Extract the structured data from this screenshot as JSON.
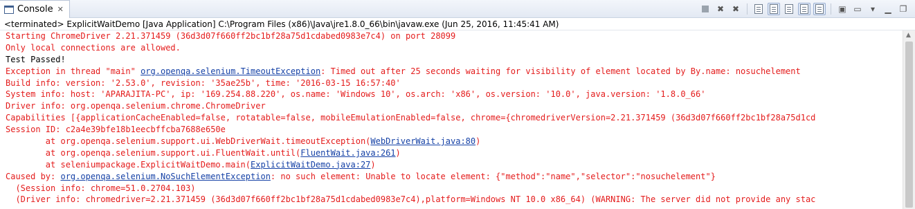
{
  "tab": {
    "label": "Console",
    "close": "✕",
    "icon": "console-icon"
  },
  "toolbar": {
    "icons": [
      "terminate-icon",
      "remove-launch-icon",
      "remove-all-terminated-icon",
      "scroll-lock-icon",
      "word-wrap-icon",
      "show-on-stdout-icon",
      "show-on-stderr-icon",
      "pin-console-icon",
      "display-selected-console-icon",
      "open-console-icon",
      "view-menu-icon",
      "minimize-icon",
      "maximize-icon"
    ]
  },
  "status": "<terminated> ExplicitWaitDemo [Java Application] C:\\Program Files (x86)\\Java\\jre1.8.0_66\\bin\\javaw.exe (Jun 25, 2016, 11:45:41 AM)",
  "colors": {
    "stderr": "#e41b1b",
    "stdout": "#000000",
    "link": "#1541a6"
  },
  "lines": [
    {
      "stream": "err",
      "parts": [
        {
          "t": "Starting ChromeDriver 2.21.371459 (36d3d07f660ff2bc1bf28a75d1cdabed0983e7c4) on port 28099"
        }
      ]
    },
    {
      "stream": "err",
      "parts": [
        {
          "t": "Only local connections are allowed."
        }
      ]
    },
    {
      "stream": "out",
      "parts": [
        {
          "t": "Test Passed!"
        }
      ]
    },
    {
      "stream": "err",
      "parts": [
        {
          "t": "Exception in thread \"main\" "
        },
        {
          "t": "org.openqa.selenium.TimeoutException",
          "link": true
        },
        {
          "t": ": Timed out after 25 seconds waiting for visibility of element located by By.name: nosuchelement"
        }
      ]
    },
    {
      "stream": "err",
      "parts": [
        {
          "t": "Build info: version: '2.53.0', revision: '35ae25b', time: '2016-03-15 16:57:40'"
        }
      ]
    },
    {
      "stream": "err",
      "parts": [
        {
          "t": "System info: host: 'APARAJITA-PC', ip: '169.254.88.220', os.name: 'Windows 10', os.arch: 'x86', os.version: '10.0', java.version: '1.8.0_66'"
        }
      ]
    },
    {
      "stream": "err",
      "parts": [
        {
          "t": "Driver info: org.openqa.selenium.chrome.ChromeDriver"
        }
      ]
    },
    {
      "stream": "err",
      "parts": [
        {
          "t": "Capabilities [{applicationCacheEnabled=false, rotatable=false, mobileEmulationEnabled=false, chrome={chromedriverVersion=2.21.371459 (36d3d07f660ff2bc1bf28a75d1cd"
        }
      ]
    },
    {
      "stream": "err",
      "parts": [
        {
          "t": "Session ID: c2a4e39bfe18b1eecbffcba7688e650e"
        }
      ]
    },
    {
      "stream": "err",
      "parts": [
        {
          "t": "\tat org.openqa.selenium.support.ui.WebDriverWait.timeoutException("
        },
        {
          "t": "WebDriverWait.java:80",
          "link": true
        },
        {
          "t": ")"
        }
      ]
    },
    {
      "stream": "err",
      "parts": [
        {
          "t": "\tat org.openqa.selenium.support.ui.FluentWait.until("
        },
        {
          "t": "FluentWait.java:261",
          "link": true
        },
        {
          "t": ")"
        }
      ]
    },
    {
      "stream": "err",
      "parts": [
        {
          "t": "\tat seleniumpackage.ExplicitWaitDemo.main("
        },
        {
          "t": "ExplicitWaitDemo.java:27",
          "link": true
        },
        {
          "t": ")"
        }
      ]
    },
    {
      "stream": "err",
      "parts": [
        {
          "t": "Caused by: "
        },
        {
          "t": "org.openqa.selenium.NoSuchElementException",
          "link": true
        },
        {
          "t": ": no such element: Unable to locate element: {\"method\":\"name\",\"selector\":\"nosuchelement\"}"
        }
      ]
    },
    {
      "stream": "err",
      "parts": [
        {
          "t": "  (Session info: chrome=51.0.2704.103)"
        }
      ]
    },
    {
      "stream": "err",
      "parts": [
        {
          "t": "  (Driver info: chromedriver=2.21.371459 (36d3d07f660ff2bc1bf28a75d1cdabed0983e7c4),platform=Windows NT 10.0 x86_64) (WARNING: The server did not provide any stac"
        }
      ]
    }
  ]
}
